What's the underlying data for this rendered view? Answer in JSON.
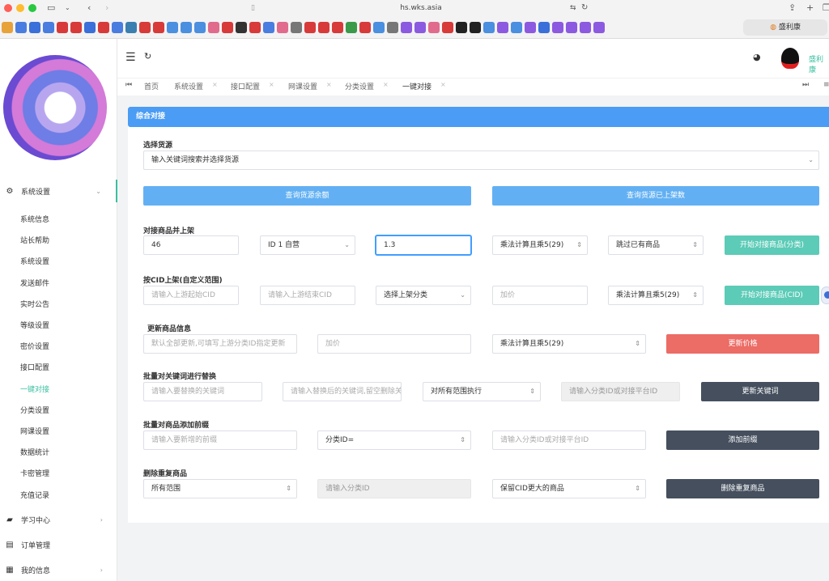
{
  "browser": {
    "url": "hs.wks.asia",
    "active_tab": "盛利康",
    "favicon_colors": [
      "#e8a23a",
      "#4a7de0",
      "#3b6fd9",
      "#4a7de0",
      "#d83a3a",
      "#d83a3a",
      "#3b6fd9",
      "#d83a3a",
      "#4a7de0",
      "#3b7fb0",
      "#d83a3a",
      "#d83a3a",
      "#4a8fe0",
      "#4a8fe0",
      "#4a8fe0",
      "#e06b8c",
      "#d83a3a",
      "#333333",
      "#d83a3a",
      "#4a7de0",
      "#e06b8c",
      "#777777",
      "#d83a3a",
      "#d83a3a",
      "#d83a3a",
      "#3a9a4a",
      "#d83a3a",
      "#4a8fe0",
      "#777777",
      "#8c5ae0",
      "#8c5ae0",
      "#e06b8c",
      "#d83a3a",
      "#222222",
      "#222222",
      "#4a8fe0",
      "#8c5ae0",
      "#4a8fe0",
      "#8c5ae0",
      "#3b6fd9",
      "#8c5ae0",
      "#8c5ae0",
      "#8c5ae0",
      "#8c5ae0"
    ]
  },
  "sidebar": {
    "groups": [
      {
        "label": "系统设置",
        "icon": "gear-icon",
        "glyph": "⚙",
        "expanded": true
      },
      {
        "label": "学习中心",
        "icon": "book-icon",
        "glyph": "▰"
      },
      {
        "label": "订单管理",
        "icon": "document-icon",
        "glyph": "▤"
      },
      {
        "label": "我的信息",
        "icon": "grid-icon",
        "glyph": "▦"
      }
    ],
    "sub_items": [
      "系统信息",
      "站长帮助",
      "系统设置",
      "发送邮件",
      "实时公告",
      "等级设置",
      "密价设置",
      "接口配置",
      "一键对接",
      "分类设置",
      "网课设置",
      "数据统计",
      "卡密管理",
      "充值记录"
    ],
    "active_sub": "一键对接"
  },
  "header": {
    "user_name": "盛利康"
  },
  "tabs": {
    "items": [
      "首页",
      "系统设置",
      "接口配置",
      "网课设置",
      "分类设置",
      "一键对接"
    ]
  },
  "card": {
    "title": "综合对接",
    "source": {
      "label": "选择货源",
      "placeholder": "输入关键词搜索并选择货源",
      "btn_balance": "查询货源余额",
      "btn_listed": "查询货源已上架数"
    },
    "dock": {
      "label": "对接商品并上架",
      "id_value": "46",
      "category_value": "ID 1 自营",
      "multiplier_value": "1.3",
      "calc_mode": "乘法计算且乘5(29)",
      "skip_mode": "跳过已有商品",
      "btn": "开始对接商品(分类)"
    },
    "cid": {
      "label": "按CID上架(自定义范围)",
      "start_ph": "请输入上游起始CID",
      "end_ph": "请输入上游结束CID",
      "category": "选择上架分类",
      "price_ph": "加价",
      "calc_mode": "乘法计算且乘5(29)",
      "btn": "开始对接商品(CID)"
    },
    "update": {
      "label": "更新商品信息",
      "scope_ph": "默认全部更新,可填写上游分类ID指定更新",
      "price_ph": "加价",
      "calc_mode": "乘法计算且乘5(29)",
      "btn": "更新价格"
    },
    "replace": {
      "label": "批量对关键词进行替换",
      "kw_ph": "请输入要替换的关键词",
      "new_ph": "请输入替换后的关键词,留空删除关键词",
      "scope": "对所有范围执行",
      "target_ph": "请输入分类ID或对接平台ID",
      "btn": "更新关键词"
    },
    "prefix": {
      "label": "批量对商品添加前缀",
      "prefix_ph": "请输入要新增的前缀",
      "type": "分类ID=",
      "target_ph": "请输入分类ID或对接平台ID",
      "btn": "添加前缀"
    },
    "dedupe": {
      "label": "删除重复商品",
      "scope": "所有范围",
      "cat_ph": "请输入分类ID",
      "keep": "保留CID更大的商品",
      "btn": "删除重复商品"
    }
  }
}
